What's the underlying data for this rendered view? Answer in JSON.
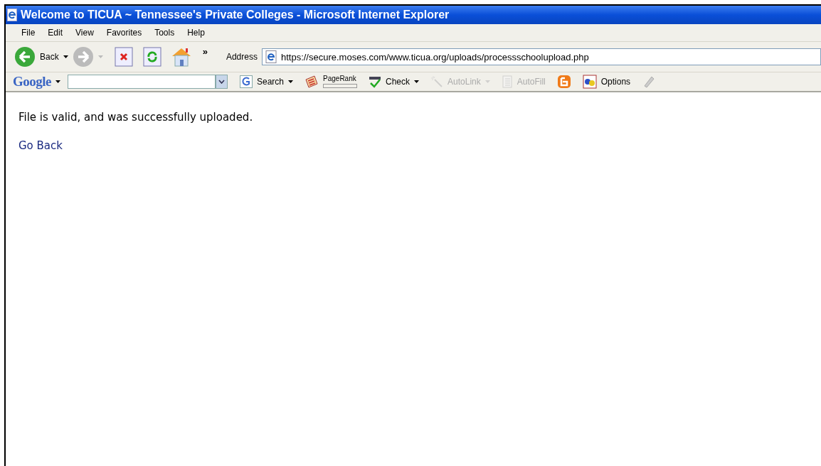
{
  "window": {
    "title": "Welcome to TICUA ~ Tennessee's Private Colleges - Microsoft Internet Explorer"
  },
  "menu": [
    "File",
    "Edit",
    "View",
    "Favorites",
    "Tools",
    "Help"
  ],
  "toolbar": {
    "back_label": "Back",
    "chevron": "»",
    "address_label": "Address",
    "address": "https://secure.moses.com/www.ticua.org/uploads/processschoolupload.php"
  },
  "google_bar": {
    "logo": "Google",
    "items": [
      {
        "kind": "search",
        "label": "Search",
        "dropdown": true,
        "disabled": false
      },
      {
        "kind": "pagerank",
        "label": "PageRank",
        "dropdown": false,
        "disabled": false
      },
      {
        "kind": "check",
        "label": "Check",
        "dropdown": true,
        "disabled": false
      },
      {
        "kind": "autolink",
        "label": "AutoLink",
        "dropdown": true,
        "disabled": true
      },
      {
        "kind": "autofill",
        "label": "AutoFill",
        "dropdown": false,
        "disabled": true
      },
      {
        "kind": "blogger",
        "dropdown": false,
        "disabled": false
      },
      {
        "kind": "options",
        "label": "Options",
        "dropdown": false,
        "disabled": false
      },
      {
        "kind": "highlighter",
        "dropdown": false,
        "disabled": false
      }
    ]
  },
  "content": {
    "message": "File is valid, and was successfully uploaded.",
    "link": "Go Back"
  }
}
